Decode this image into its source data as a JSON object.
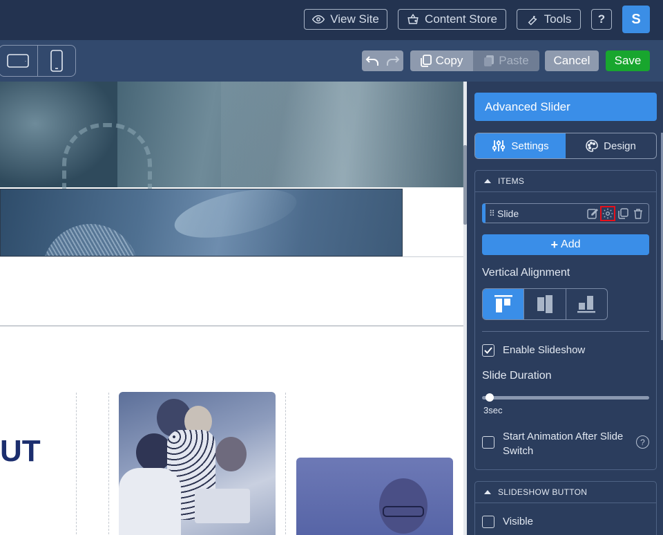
{
  "topbar": {
    "view_site": "View Site",
    "content_store": "Content Store",
    "tools": "Tools",
    "help": "?",
    "avatar_initial": "S"
  },
  "toolbar": {
    "copy": "Copy",
    "paste": "Paste",
    "cancel": "Cancel",
    "save": "Save"
  },
  "canvas": {
    "heading_fragment": "UT"
  },
  "panel": {
    "title": "Advanced Slider",
    "tabs": [
      {
        "label": "Settings",
        "active": true
      },
      {
        "label": "Design",
        "active": false
      }
    ],
    "items_section": {
      "header": "ITEMS",
      "items": [
        {
          "label": "Slide"
        }
      ],
      "add_label": "Add"
    },
    "vertical_alignment_label": "Vertical Alignment",
    "enable_slideshow": {
      "label": "Enable Slideshow",
      "checked": true
    },
    "slide_duration": {
      "label": "Slide Duration",
      "value_text": "3sec",
      "value": 3
    },
    "start_animation": {
      "label_line1": "Start Animation After Slide",
      "label_line2": "Switch",
      "checked": false
    },
    "slideshow_button_section": {
      "header": "SLIDESHOW BUTTON",
      "visible": {
        "label": "Visible",
        "checked": false
      }
    }
  },
  "colors": {
    "accent": "#3a8ee8",
    "save": "#18a62e",
    "panel_bg": "#2b3d5d",
    "topbar_bg": "#233350",
    "highlight": "#e8101a"
  }
}
